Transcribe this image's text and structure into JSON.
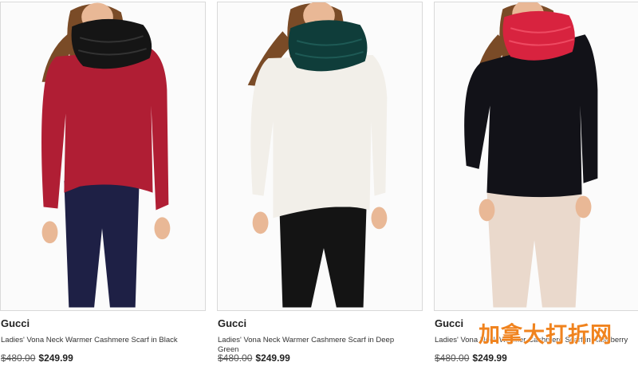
{
  "products": [
    {
      "brand": "Gucci",
      "title": "Ladies' Vona Neck Warmer Cashmere Scarf in Black",
      "original_price": "$480.00",
      "sale_price": "$249.99",
      "scarf_color": "#151515",
      "top_color": "#b01e34",
      "pants_color": "#1e2045"
    },
    {
      "brand": "Gucci",
      "title": "Ladies' Vona Neck Warmer Cashmere Scarf in Deep Green",
      "original_price": "$480.00",
      "sale_price": "$249.99",
      "scarf_color": "#0f3d3a",
      "top_color": "#f2efe9",
      "pants_color": "#141414"
    },
    {
      "brand": "Gucci",
      "title": "Ladies' Vona Neck Warmer Cashmere Scarf in Raspberry",
      "original_price": "$480.00",
      "sale_price": "$249.99",
      "scarf_color": "#d8233f",
      "top_color": "#121218",
      "pants_color": "#ead9cc"
    }
  ],
  "watermark": "加拿大打折网",
  "colors": {
    "skin": "#e9b896",
    "hair": "#7a4b27",
    "watermark": "#f0831e"
  }
}
